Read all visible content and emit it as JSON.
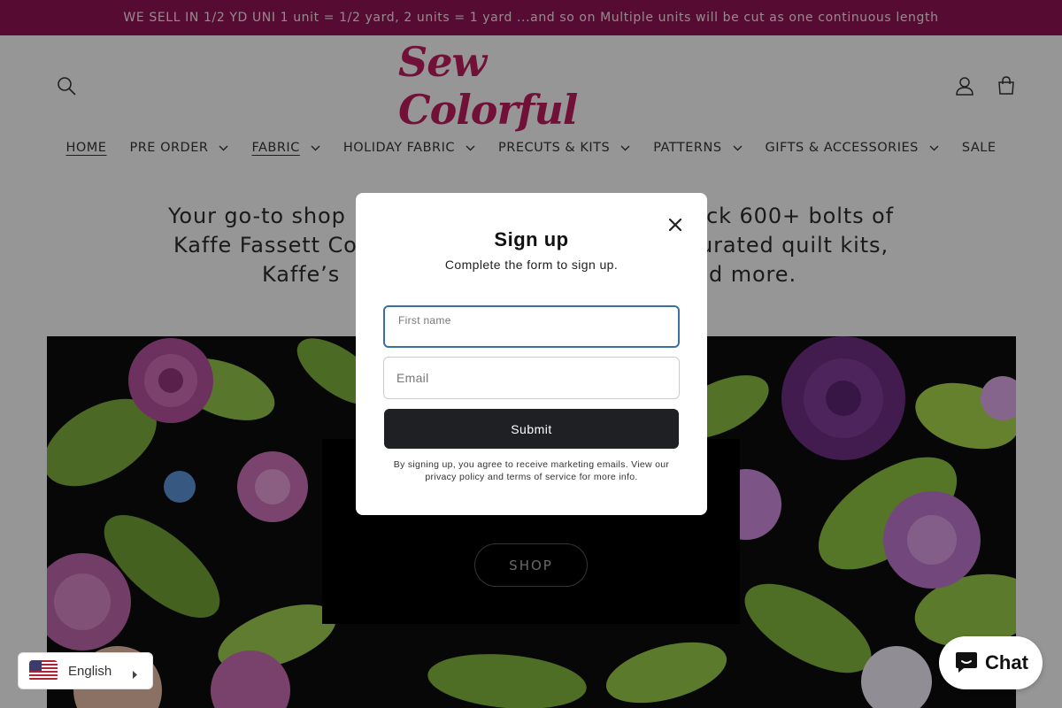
{
  "announcement": "WE SELL IN 1/2 YD UNI 1 unit = 1/2 yard, 2 units = 1 yard ...and so on Multiple units will be cut as one continuous length",
  "brand": {
    "logo_text": "Sew Colorful",
    "accent": "#b81c5b",
    "bar_color": "#8b1452"
  },
  "header": {
    "search_icon": "search-icon",
    "account_icon": "user-icon",
    "cart_icon": "cart-icon"
  },
  "nav": [
    {
      "label": "HOME",
      "dropdown": false,
      "underlined": true
    },
    {
      "label": "PRE ORDER",
      "dropdown": true,
      "underlined": false
    },
    {
      "label": "FABRIC",
      "dropdown": true,
      "underlined": true
    },
    {
      "label": "HOLIDAY FABRIC",
      "dropdown": true,
      "underlined": false
    },
    {
      "label": "PRECUTS & KITS",
      "dropdown": true,
      "underlined": false
    },
    {
      "label": "PATTERNS",
      "dropdown": true,
      "underlined": false
    },
    {
      "label": "GIFTS & ACCESSORIES",
      "dropdown": true,
      "underlined": false
    },
    {
      "label": "SALE",
      "dropdown": false,
      "underlined": false
    }
  ],
  "tagline": {
    "line1": "Your go-to shop",
    "line1_end": "ck 600+ bolts of",
    "line2": "Kaffe Fassett Co",
    "line2_end": "urated quilt kits,",
    "line3": "Kaffe’s",
    "line3_end": "d more."
  },
  "hero": {
    "button": "SHOP"
  },
  "modal": {
    "title": "Sign up",
    "subtitle": "Complete the form to sign up.",
    "first_name_label": "First name",
    "first_name_value": "",
    "email_placeholder": "Email",
    "submit": "Submit",
    "legal": "By signing up, you agree to receive marketing emails. View our privacy policy and terms of service for more info."
  },
  "language": {
    "label": "English",
    "flag": "us-flag-icon"
  },
  "chat": {
    "label": "Chat"
  }
}
